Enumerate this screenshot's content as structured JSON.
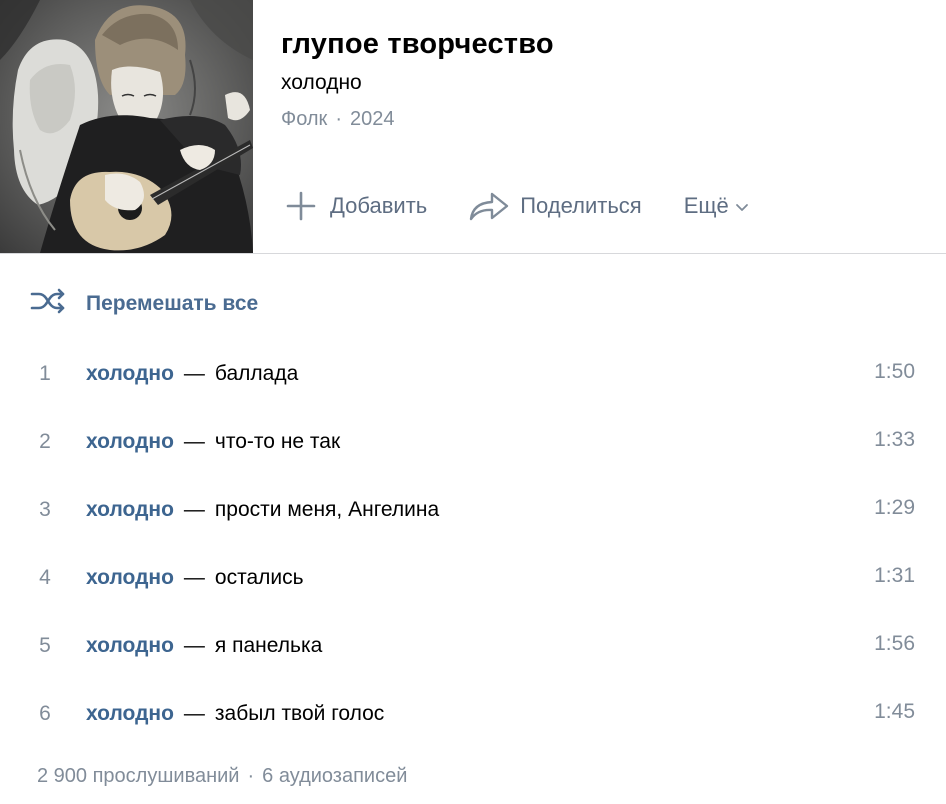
{
  "album": {
    "cover_alt": "cover-art",
    "title": "глупое творчество",
    "artist": "холодно",
    "genre": "Фолк",
    "separator": "·",
    "year": "2024"
  },
  "actions": {
    "add_label": "Добавить",
    "share_label": "Поделиться",
    "more_label": "Ещё"
  },
  "shuffle": {
    "label": "Перемешать все"
  },
  "tracks": [
    {
      "num": "1",
      "artist": "холодно",
      "dash": "—",
      "title": "баллада",
      "duration": "1:50"
    },
    {
      "num": "2",
      "artist": "холодно",
      "dash": "—",
      "title": "что-то не так",
      "duration": "1:33"
    },
    {
      "num": "3",
      "artist": "холодно",
      "dash": "—",
      "title": "прости меня, Ангелина",
      "duration": "1:29"
    },
    {
      "num": "4",
      "artist": "холодно",
      "dash": "—",
      "title": "остались",
      "duration": "1:31"
    },
    {
      "num": "5",
      "artist": "холодно",
      "dash": "—",
      "title": "я панелька",
      "duration": "1:56"
    },
    {
      "num": "6",
      "artist": "холодно",
      "dash": "—",
      "title": "забыл твой голос",
      "duration": "1:45"
    }
  ],
  "footer": {
    "listens": "2 900 прослушиваний",
    "separator": "·",
    "count": "6 аудиозаписей"
  },
  "colors": {
    "link": "#3d6590",
    "accent_text": "#4a6b91",
    "secondary": "#818c99",
    "action": "#5e6d82",
    "divider": "#d7d8db"
  }
}
